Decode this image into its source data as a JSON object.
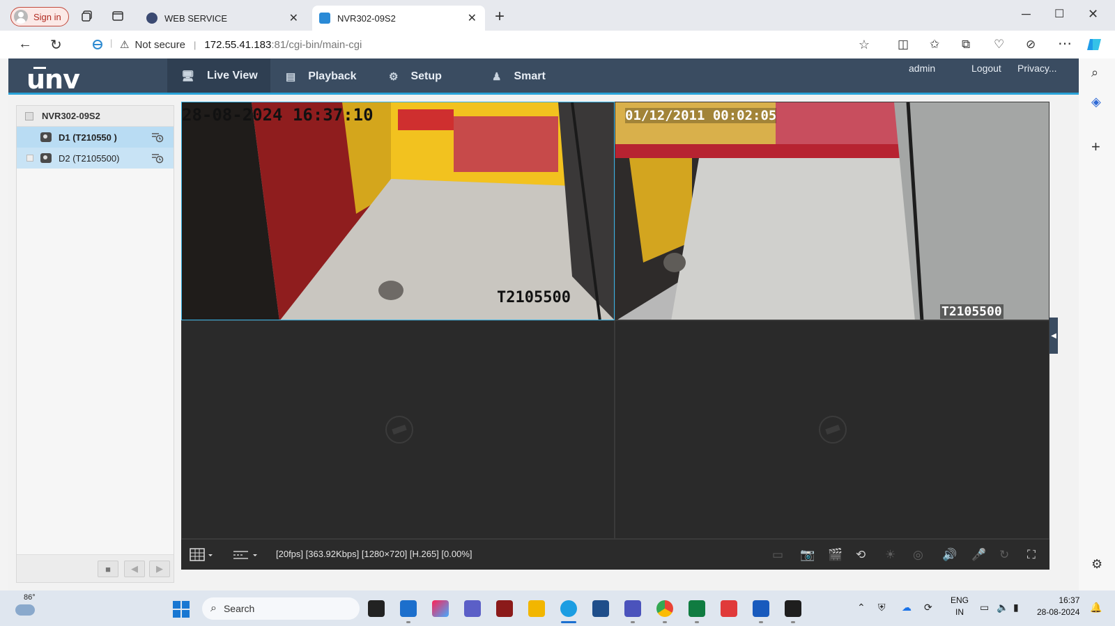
{
  "browser": {
    "signin_label": "Sign in",
    "tabs": [
      {
        "title": "WEB SERVICE",
        "active": false
      },
      {
        "title": "NVR302-09S2",
        "active": true
      }
    ],
    "security_label": "Not secure",
    "url_host": "172.55.41.183",
    "url_rest": ":81/cgi-bin/main-cgi"
  },
  "app": {
    "logo": "unv",
    "menu": [
      {
        "label": "Live View",
        "icon": "monitor-icon",
        "active": true
      },
      {
        "label": "Playback",
        "icon": "playback-icon",
        "active": false
      },
      {
        "label": "Setup",
        "icon": "gear-icon",
        "active": false
      },
      {
        "label": "Smart",
        "icon": "person-icon",
        "active": false
      }
    ],
    "top_links": {
      "user": "admin",
      "logout": "Logout",
      "privacy": "Privacy..."
    },
    "device_tree": {
      "root": "NVR302-09S2",
      "channels": [
        {
          "label": "D1 (T210550 )",
          "selected": true
        },
        {
          "label": "D2 (T2105500)",
          "selected": false
        }
      ]
    },
    "cameras": [
      {
        "timestamp": "28-08-2024 16:37:10",
        "name": "T2105500"
      },
      {
        "timestamp": "01/12/2011 00:02:05",
        "name": "T2105500"
      }
    ],
    "stream_info": "[20fps] [363.92Kbps] [1280×720] [H.265] [0.00%]"
  },
  "taskbar": {
    "temperature": "86°",
    "search_placeholder": "Search",
    "lang_line1": "ENG",
    "lang_line2": "IN",
    "time": "16:37",
    "date": "28-08-2024"
  },
  "colors": {
    "header_bg": "#3a4c61",
    "accent": "#2aa3d8",
    "tree_selected": "#b9dcf3"
  }
}
